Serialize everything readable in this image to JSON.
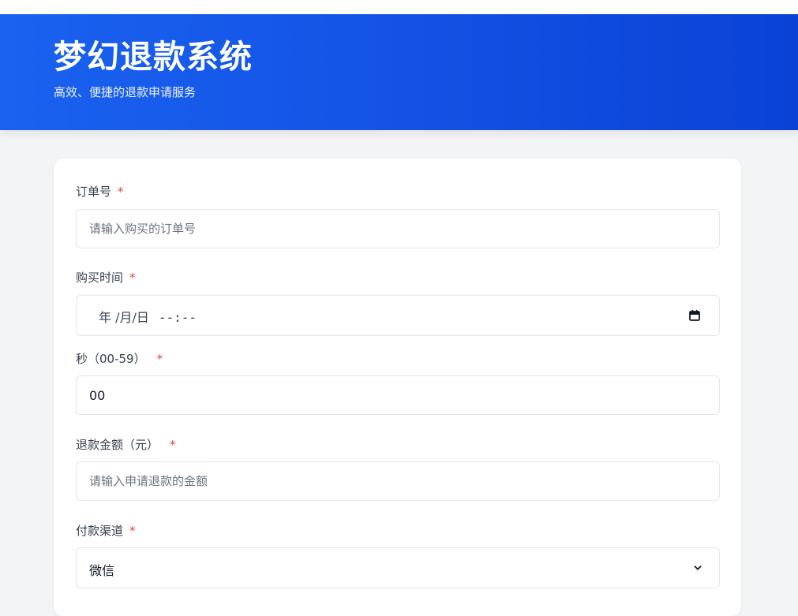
{
  "header": {
    "title": "梦幻退款系统",
    "subtitle": "高效、便捷的退款申请服务"
  },
  "form": {
    "required_mark": "*",
    "order": {
      "label": "订单号",
      "placeholder": "请输入购买的订单号",
      "value": ""
    },
    "purchase_time": {
      "label": "购买时间",
      "date_placeholder": "年 /月/日",
      "time_placeholder": "--:--"
    },
    "seconds": {
      "label": "秒（00-59）",
      "value": "00"
    },
    "amount": {
      "label": "退款金额（元）",
      "placeholder": "请输入申请退款的金额",
      "value": ""
    },
    "channel": {
      "label": "付款渠道",
      "selected": "微信"
    }
  },
  "icons": {
    "calendar": "calendar-icon",
    "select_arrow": "chevron-down-icon"
  },
  "colors": {
    "header_start": "#1a62f0",
    "header_end": "#0a42d6",
    "required": "#e53e3e",
    "page_bg": "#f3f4f6"
  }
}
